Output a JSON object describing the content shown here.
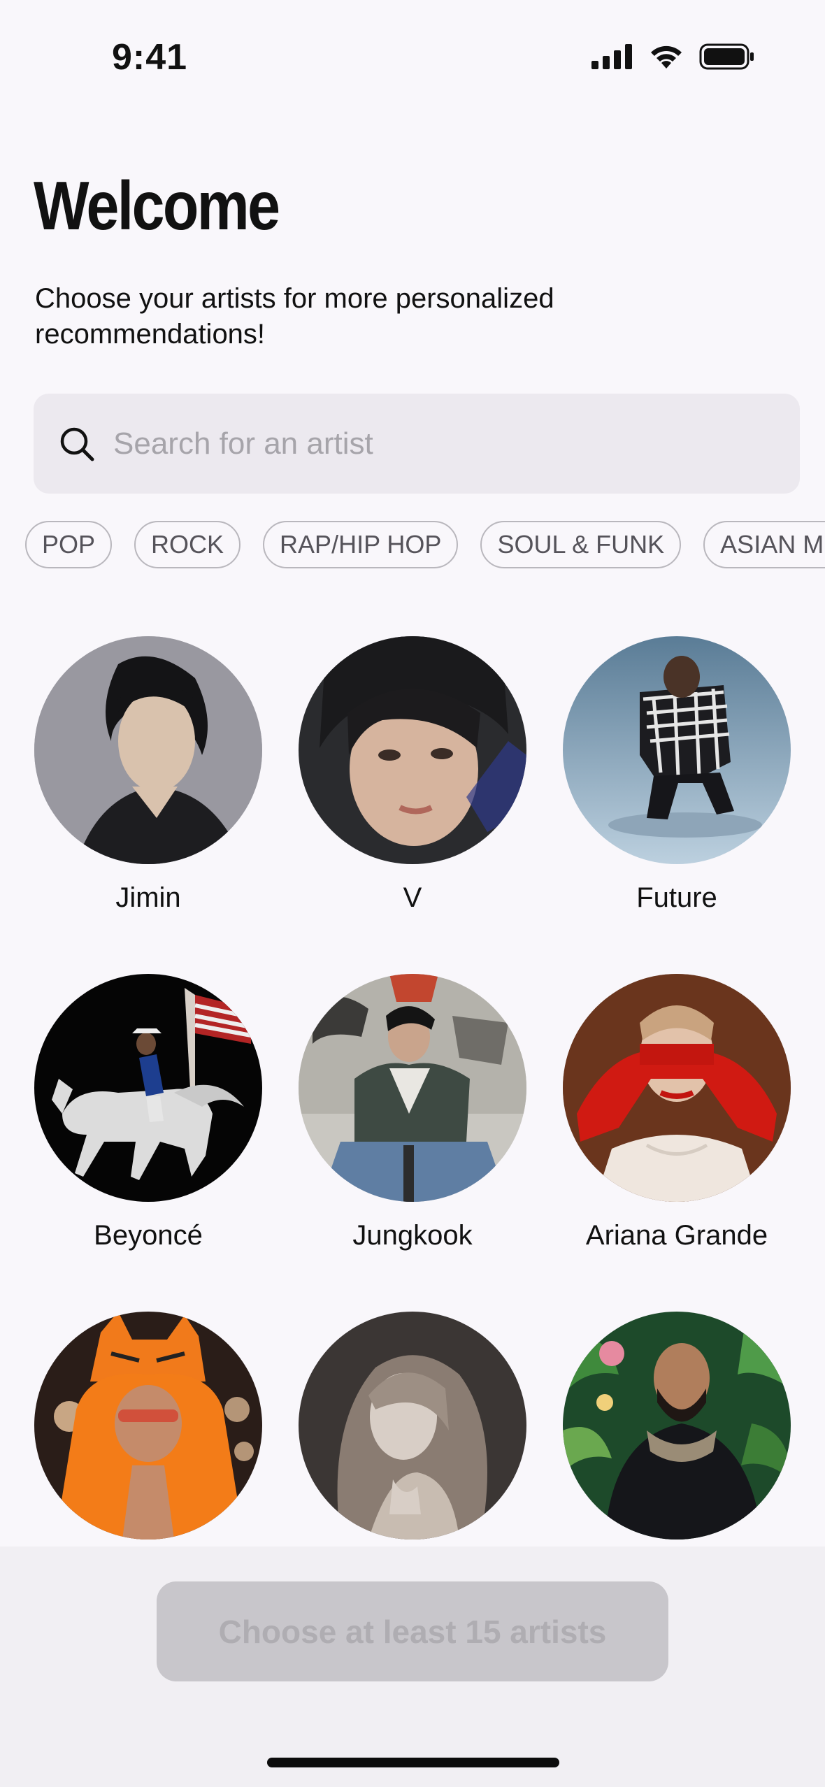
{
  "status_bar": {
    "time": "9:41",
    "icons": [
      "cellular-signal-icon",
      "wifi-icon",
      "battery-icon"
    ]
  },
  "header": {
    "title": "Welcome",
    "subtitle": "Choose your artists for more personalized recommendations!"
  },
  "search": {
    "placeholder": "Search for an artist",
    "value": ""
  },
  "genres": [
    "POP",
    "ROCK",
    "RAP/HIP HOP",
    "SOUL & FUNK",
    "ASIAN MUSIC"
  ],
  "artists": [
    {
      "name": "Jimin"
    },
    {
      "name": "V"
    },
    {
      "name": "Future"
    },
    {
      "name": "Beyoncé"
    },
    {
      "name": "Jungkook"
    },
    {
      "name": "Ariana Grande"
    },
    {
      "name": ""
    },
    {
      "name": ""
    },
    {
      "name": ""
    }
  ],
  "cta": {
    "label": "Choose at least 15 artists",
    "enabled": false
  },
  "colors": {
    "background": "#f9f7fb",
    "search_bg": "#ece9ef",
    "chip_border": "#b9b7bd",
    "cta_disabled_bg": "#c8c6cb",
    "cta_disabled_text": "#afadb2"
  }
}
